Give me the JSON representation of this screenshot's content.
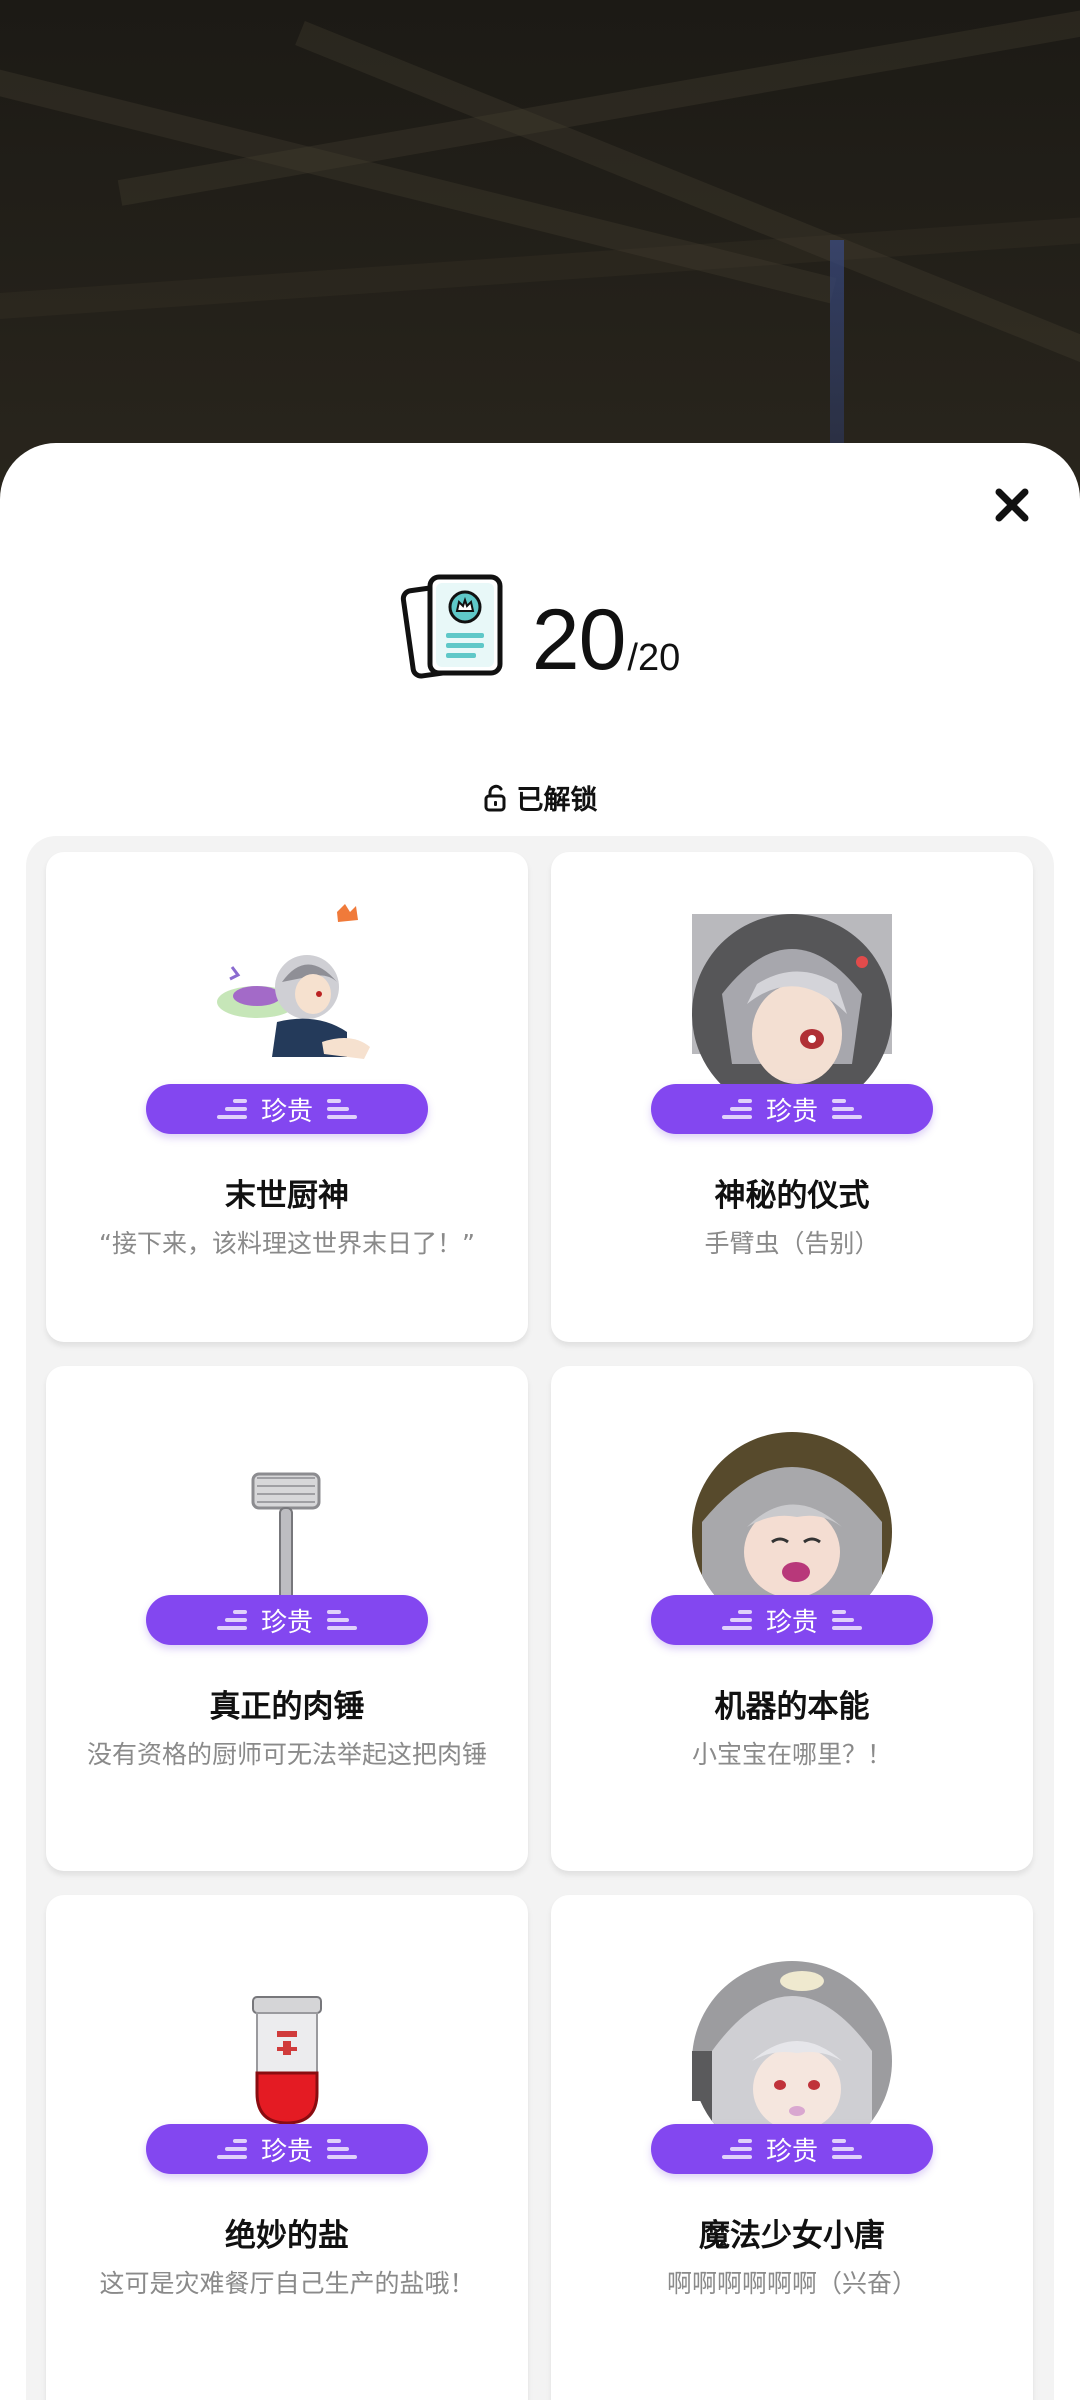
{
  "header": {
    "close_icon": "close-icon",
    "collection_icon": "card-collection-icon",
    "count_unlocked": "20",
    "count_total": "/20"
  },
  "filter": {
    "icon": "unlock-icon",
    "label": "已解锁"
  },
  "cards": [
    {
      "badge": "珍贵",
      "title": "末世厨神",
      "desc": "“接下来，该料理这世界末日了！”",
      "art": "chef-character"
    },
    {
      "badge": "珍贵",
      "title": "神秘的仪式",
      "desc": "手臂虫（告别）",
      "art": "portrait-girl-1"
    },
    {
      "badge": "珍贵",
      "title": "真正的肉锤",
      "desc": "没有资格的厨师可无法举起这把肉锤",
      "art": "meat-hammer"
    },
    {
      "badge": "珍贵",
      "title": "机器的本能",
      "desc": "小宝宝在哪里？！",
      "art": "portrait-girl-2"
    },
    {
      "badge": "珍贵",
      "title": "绝妙的盐",
      "desc": "这可是灾难餐厅自己生产的盐哦！",
      "art": "salt-shaker"
    },
    {
      "badge": "珍贵",
      "title": "魔法少女小唐",
      "desc": "啊啊啊啊啊啊（兴奋）",
      "art": "portrait-girl-3"
    }
  ],
  "colors": {
    "badge": "#8347f0",
    "accent_card": "#5fc8c8"
  }
}
